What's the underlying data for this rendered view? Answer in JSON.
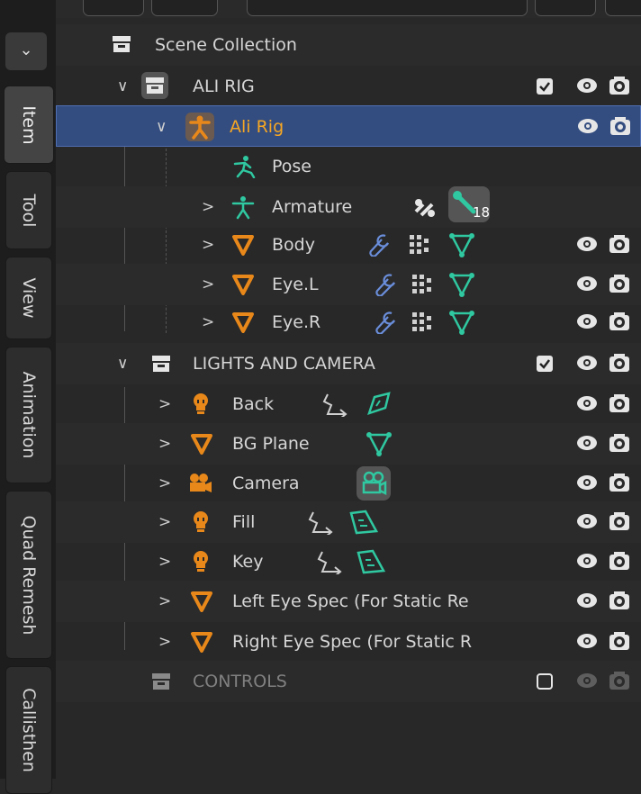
{
  "sidebar_tabs": [
    "Item",
    "Tool",
    "View",
    "Animation",
    "Quad Remesh",
    "Callisthen"
  ],
  "dropdown_glyph": "⌄",
  "outliner": {
    "scene_collection": "Scene Collection",
    "rows": {
      "ali_rig_collection": "ALI RIG",
      "ali_rig_object": "Ali Rig",
      "pose": "Pose",
      "armature": "Armature",
      "armature_badge": "18",
      "body": "Body",
      "eye_l": "Eye.L",
      "eye_r": "Eye.R",
      "lights_collection": "LIGHTS AND CAMERA",
      "back": "Back",
      "bg_plane": "BG Plane",
      "camera": "Camera",
      "fill": "Fill",
      "key": "Key",
      "left_eye_spec": "Left Eye Spec (For Static Re",
      "right_eye_spec": "Right Eye Spec (For Static R",
      "controls_collection": "CONTROLS"
    },
    "chevron_open": "∨",
    "chevron_closed": ">"
  },
  "colors": {
    "selected_row": "#334d80",
    "object_orange": "#e8881a",
    "modifier_blue": "#6a8edb",
    "data_green": "#2fc8a0",
    "selected_text": "#f5a623"
  }
}
